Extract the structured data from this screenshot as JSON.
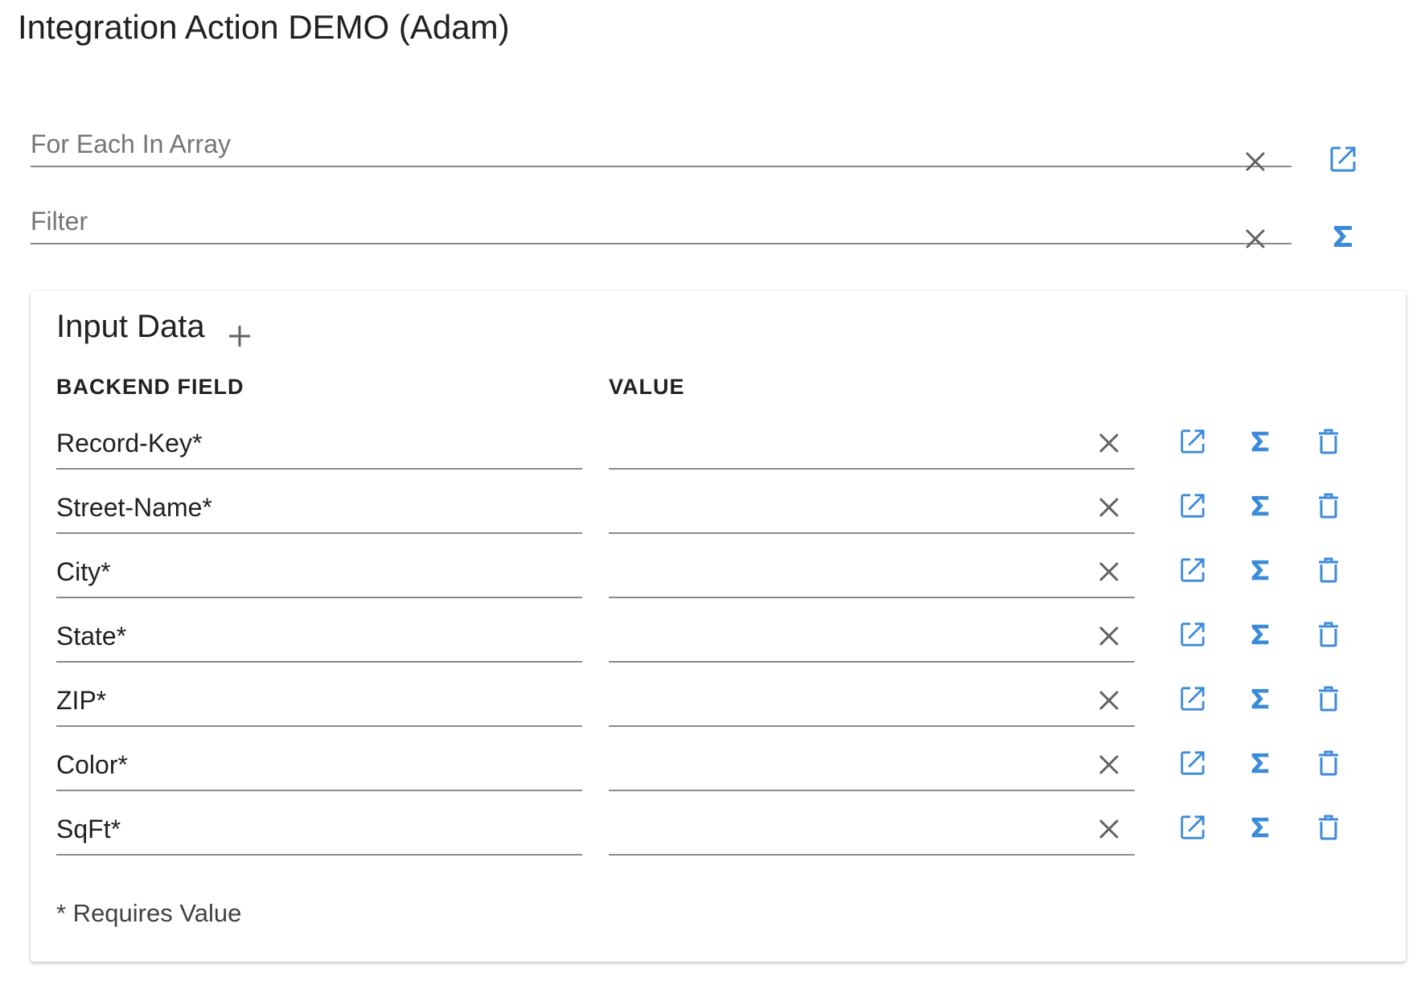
{
  "page": {
    "title": "Integration Action DEMO (Adam)"
  },
  "top_fields": {
    "for_each": {
      "placeholder": "For Each In Array",
      "value": ""
    },
    "filter": {
      "placeholder": "Filter",
      "value": ""
    }
  },
  "input_data": {
    "title": "Input Data",
    "headers": {
      "backend_field": "BACKEND FIELD",
      "value": "VALUE"
    },
    "rows": [
      {
        "field": "Record-Key*",
        "value": ""
      },
      {
        "field": "Street-Name*",
        "value": ""
      },
      {
        "field": "City*",
        "value": ""
      },
      {
        "field": "State*",
        "value": ""
      },
      {
        "field": "ZIP*",
        "value": ""
      },
      {
        "field": "Color*",
        "value": ""
      },
      {
        "field": "SqFt*",
        "value": ""
      }
    ],
    "footnote": "* Requires Value"
  },
  "icons": {
    "clear": "close-icon",
    "edit": "open-in-new-icon",
    "formula": "sigma-icon",
    "delete": "trash-icon",
    "add": "plus-icon"
  },
  "colors": {
    "accent": "#3d8bd8",
    "icon_gray": "#616161",
    "underline": "#8a8a8a"
  }
}
